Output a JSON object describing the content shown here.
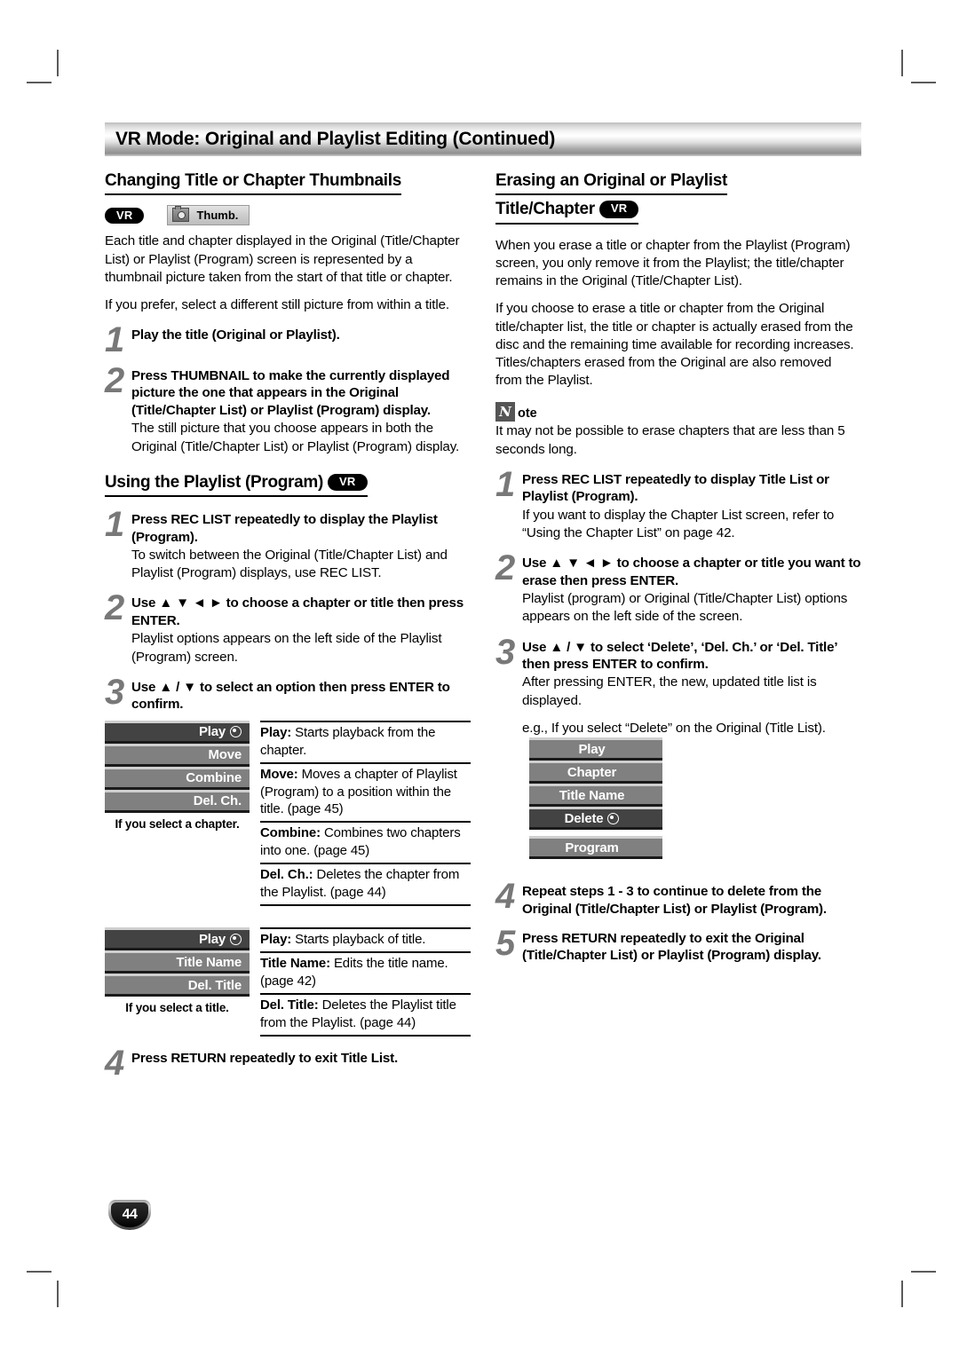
{
  "page": {
    "header_title": "VR Mode: Original and Playlist Editing (Continued)",
    "page_number": "44"
  },
  "left_column": {
    "section1": {
      "heading": "Changing Title or Chapter Thumbnails",
      "badge_vr": "VR",
      "badge_thumb": "Thumb.",
      "paragraphs": [
        "Each title and chapter displayed in the Original (Title/Chapter List) or Playlist (Program) screen is represented by a thumbnail picture taken from the start of that title or chapter.",
        "If you prefer, select a different still picture from within a title."
      ],
      "steps": [
        {
          "num": "1",
          "head": "Play the title (Original or Playlist).",
          "sub": ""
        },
        {
          "num": "2",
          "head": "Press THUMBNAIL to make the currently displayed picture the one that appears in the Original (Title/Chapter List) or Playlist (Program) display.",
          "sub": "The still picture that you choose appears in both the Original (Title/Chapter List) or Playlist (Program) display."
        }
      ]
    },
    "section2": {
      "heading": "Using the Playlist (Program)",
      "badge_vr": "VR",
      "steps": [
        {
          "num": "1",
          "head": "Press REC LIST repeatedly to display the Playlist (Program).",
          "sub": "To switch between the Original (Title/Chapter List) and Playlist (Program) displays, use REC LIST."
        },
        {
          "num": "2",
          "head": "Use ▲ ▼ ◄ ► to choose a chapter or title then press ENTER.",
          "sub": "Playlist options appears on the left side of the Playlist (Program) screen."
        },
        {
          "num": "3",
          "head": "Use ▲ / ▼ to select an option then press ENTER to confirm.",
          "sub": ""
        },
        {
          "num": "4",
          "head": "Press RETURN repeatedly to exit Title List.",
          "sub": ""
        }
      ],
      "menu_chapter": {
        "items": [
          {
            "label": "Play",
            "selected": true,
            "has_dot": true
          },
          {
            "label": "Move",
            "selected": false,
            "has_dot": false
          },
          {
            "label": "Combine",
            "selected": false,
            "has_dot": false
          },
          {
            "label": "Del. Ch.",
            "selected": false,
            "has_dot": false
          }
        ],
        "caption": "If you select a chapter.",
        "definitions": [
          {
            "term": "Play:",
            "desc": " Starts playback from the chapter."
          },
          {
            "term": "Move:",
            "desc": " Moves a chapter of Playlist (Program) to a position within the title. (page 45)"
          },
          {
            "term": "Combine:",
            "desc": " Combines two chapters into one. (page 45)"
          },
          {
            "term": "Del. Ch.:",
            "desc": " Deletes the chapter from the Playlist. (page 44)"
          }
        ]
      },
      "menu_title": {
        "items": [
          {
            "label": "Play",
            "selected": true,
            "has_dot": true
          },
          {
            "label": "Title Name",
            "selected": false,
            "has_dot": false
          },
          {
            "label": "Del. Title",
            "selected": false,
            "has_dot": false
          }
        ],
        "caption": "If you select a title.",
        "definitions": [
          {
            "term": "Play:",
            "desc": " Starts playback of title."
          },
          {
            "term": "Title Name:",
            "desc": " Edits the title name. (page 42)"
          },
          {
            "term": "Del. Title:",
            "desc": " Deletes the Playlist title from the Playlist. (page 44)"
          }
        ]
      }
    }
  },
  "right_column": {
    "heading_line1": "Erasing an Original or Playlist",
    "heading_line2": "Title/Chapter",
    "badge_vr": "VR",
    "paragraphs": [
      "When you erase a title or chapter from the Playlist (Program) screen, you only remove it from the Playlist; the title/chapter remains in the Original (Title/Chapter List).",
      "If you choose to erase a title or chapter from the Original title/chapter list, the title or chapter is actually erased from the disc and the remaining time available for recording increases. Titles/chapters erased from the Original are also removed from the Playlist."
    ],
    "note": {
      "icon_letter": "N",
      "label": "ote",
      "text": "It may not be possible to erase chapters that are less than 5 seconds long."
    },
    "steps": [
      {
        "num": "1",
        "head": "Press REC LIST repeatedly to display Title List or Playlist (Program).",
        "sub": "If you want to display the Chapter List screen, refer to “Using the Chapter List” on page 42."
      },
      {
        "num": "2",
        "head": "Use ▲ ▼ ◄ ► to choose a chapter or title you want to erase then press ENTER.",
        "sub": "Playlist (program) or Original (Title/Chapter List) options appears on the left side of the screen."
      },
      {
        "num": "3",
        "head": "Use ▲ / ▼ to select ‘Delete’, ‘Del. Ch.’ or ‘Del. Title’ then press ENTER to confirm.",
        "sub": "After pressing ENTER, the new, updated title list is displayed.",
        "sub2": "e.g., If you select “Delete” on the Original (Title List)."
      },
      {
        "num": "4",
        "head": "Repeat steps 1 - 3 to continue to delete from the Original (Title/Chapter List) or Playlist (Program).",
        "sub": ""
      },
      {
        "num": "5",
        "head": "Press RETURN repeatedly to exit the Original (Title/Chapter List) or Playlist (Program) display.",
        "sub": ""
      }
    ],
    "menu_original": {
      "items": [
        {
          "label": "Play",
          "selected": false,
          "has_dot": false,
          "gap_after": false
        },
        {
          "label": "Chapter",
          "selected": false,
          "has_dot": false,
          "gap_after": false
        },
        {
          "label": "Title Name",
          "selected": false,
          "has_dot": false,
          "gap_after": false
        },
        {
          "label": "Delete",
          "selected": true,
          "has_dot": true,
          "gap_after": true
        },
        {
          "label": "Program",
          "selected": false,
          "has_dot": false,
          "gap_after": false
        }
      ]
    }
  }
}
